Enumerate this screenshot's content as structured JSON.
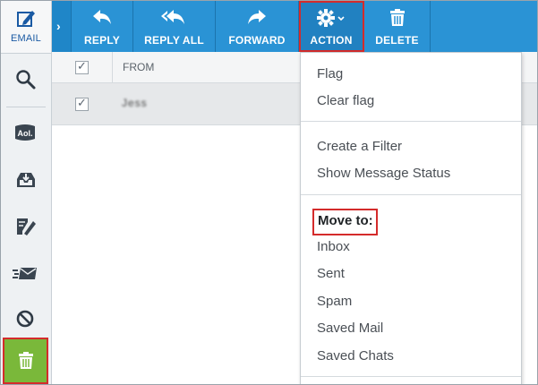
{
  "left_nav": {
    "email_label": "EMAIL",
    "items": [
      {
        "name": "search",
        "icon": "search-icon"
      },
      {
        "name": "aol",
        "icon": "aol-icon",
        "text": "Aol."
      },
      {
        "name": "inbox",
        "icon": "inbox-icon"
      },
      {
        "name": "compose",
        "icon": "compose-icon"
      },
      {
        "name": "sent",
        "icon": "sent-icon"
      },
      {
        "name": "spam",
        "icon": "block-icon"
      },
      {
        "name": "trash",
        "icon": "trash-icon",
        "selected": true
      }
    ]
  },
  "toolbar": {
    "reply_label": "REPLY",
    "reply_all_label": "REPLY ALL",
    "forward_label": "FORWARD",
    "action_label": "ACTION",
    "delete_label": "DELETE"
  },
  "list": {
    "from_header": "FROM",
    "rows": [
      {
        "checked": true,
        "sender": "Jess"
      }
    ]
  },
  "action_menu": {
    "flag": "Flag",
    "clear_flag": "Clear flag",
    "create_filter": "Create a Filter",
    "show_status": "Show Message Status",
    "move_to": "Move to:",
    "folders": [
      "Inbox",
      "Sent",
      "Spam",
      "Saved Mail",
      "Saved Chats"
    ]
  },
  "colors": {
    "toolbar": "#2a93d5",
    "trash_selected": "#7ab83a",
    "highlight": "#d42b2b"
  }
}
